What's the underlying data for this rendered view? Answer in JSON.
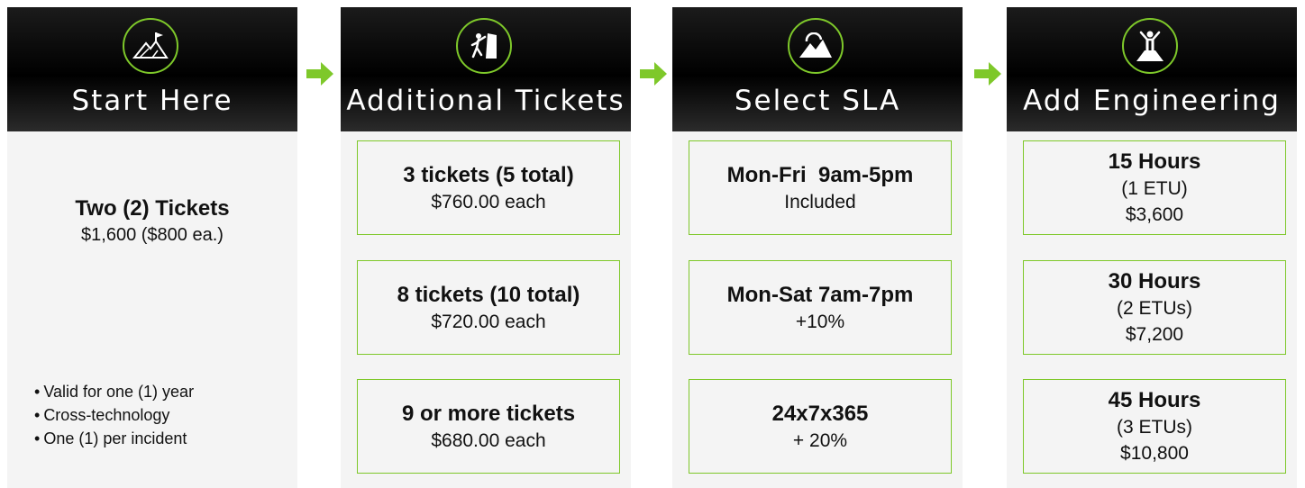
{
  "steps": [
    {
      "title": "Start Here",
      "icon": "mountain-flag-icon",
      "main_title": "Two (2) Tickets",
      "main_sub": "$1,600 ($800 ea.)",
      "bullets": [
        "Valid for one (1) year",
        "Cross-technology",
        "One (1) per incident"
      ]
    },
    {
      "title": "Additional Tickets",
      "icon": "climber-icon",
      "options": [
        {
          "title": "3 tickets (5 total)",
          "lines": [
            "$760.00 each"
          ]
        },
        {
          "title": "8 tickets (10 total)",
          "lines": [
            "$720.00 each"
          ]
        },
        {
          "title": "9 or more tickets",
          "lines": [
            "$680.00 each"
          ]
        }
      ]
    },
    {
      "title": "Select SLA",
      "icon": "mountain-peaks-icon",
      "options": [
        {
          "title": "Mon-Fri  9am-5pm",
          "lines": [
            "Included"
          ]
        },
        {
          "title": "Mon-Sat 7am-7pm",
          "lines": [
            "+10%"
          ]
        },
        {
          "title": "24x7x365",
          "lines": [
            "+ 20%"
          ]
        }
      ]
    },
    {
      "title": "Add Engineering",
      "icon": "summit-person-icon",
      "options": [
        {
          "title": "15 Hours",
          "lines": [
            "(1 ETU)",
            "$3,600"
          ]
        },
        {
          "title": "30 Hours",
          "lines": [
            "(2 ETUs)",
            "$7,200"
          ]
        },
        {
          "title": "45 Hours",
          "lines": [
            "(3 ETUs)",
            "$10,800"
          ]
        }
      ]
    }
  ],
  "colors": {
    "accent": "#7ec82a",
    "header": "#000000",
    "panel": "#f4f4f4"
  }
}
